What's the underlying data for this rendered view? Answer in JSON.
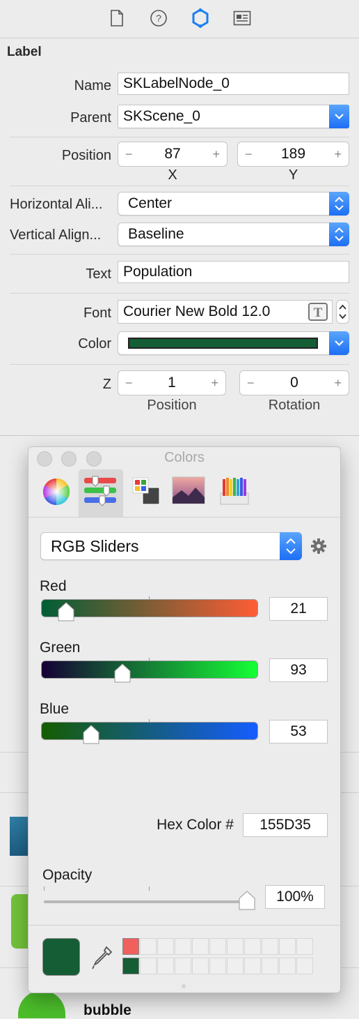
{
  "toolbar": {
    "icons": [
      "file-icon",
      "help-icon",
      "attributes-inspector-icon",
      "library-icon"
    ],
    "active_color": "#1b7ef0"
  },
  "section_title": "Label",
  "name": {
    "label": "Name",
    "value": "SKLabelNode_0"
  },
  "parent": {
    "label": "Parent",
    "value": "SKScene_0"
  },
  "position": {
    "label": "Position",
    "x": "87",
    "y": "189",
    "x_label": "X",
    "y_label": "Y"
  },
  "halign": {
    "label": "Horizontal Ali...",
    "value": "Center"
  },
  "valign": {
    "label": "Vertical Align...",
    "value": "Baseline"
  },
  "text": {
    "label": "Text",
    "value": "Population"
  },
  "font": {
    "label": "Font",
    "value": "Courier New Bold 12.0"
  },
  "color": {
    "label": "Color",
    "swatch": "#155D35"
  },
  "z": {
    "label": "Z",
    "position": "1",
    "rotation": "0",
    "position_label": "Position",
    "rotation_label": "Rotation"
  },
  "behind": {
    "last_label": "bubble"
  },
  "colors_panel": {
    "title": "Colors",
    "mode": "RGB Sliders",
    "red": {
      "label": "Red",
      "value": "21",
      "fraction": 0.082
    },
    "green": {
      "label": "Green",
      "value": "93",
      "fraction": 0.365
    },
    "blue": {
      "label": "Blue",
      "value": "53",
      "fraction": 0.208
    },
    "hex": {
      "label": "Hex Color #",
      "value": "155D35"
    },
    "opacity": {
      "label": "Opacity",
      "value": "100%",
      "fraction": 1.0
    },
    "current_color": "#155D35",
    "recent_swatches": [
      "#f0605c",
      "#155D35"
    ]
  }
}
